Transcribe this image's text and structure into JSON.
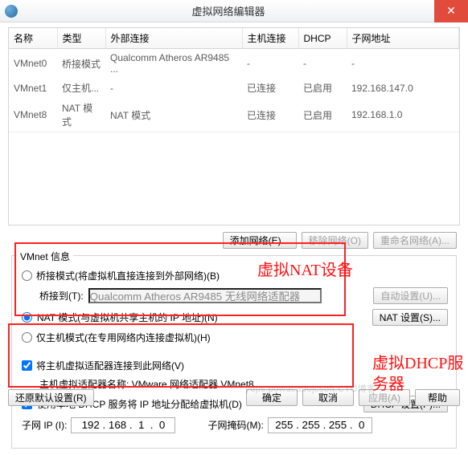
{
  "window": {
    "title": "虚拟网络编辑器",
    "close": "✕"
  },
  "table": {
    "headers": [
      "名称",
      "类型",
      "外部连接",
      "主机连接",
      "DHCP",
      "子网地址"
    ],
    "rows": [
      {
        "name": "VMnet0",
        "type": "桥接模式",
        "ext": "Qualcomm Atheros AR9485 ...",
        "host": "-",
        "dhcp": "-",
        "subnet": "-"
      },
      {
        "name": "VMnet1",
        "type": "仅主机...",
        "ext": "-",
        "host": "已连接",
        "dhcp": "已启用",
        "subnet": "192.168.147.0"
      },
      {
        "name": "VMnet8",
        "type": "NAT 模式",
        "ext": "NAT 模式",
        "host": "已连接",
        "dhcp": "已启用",
        "subnet": "192.168.1.0"
      }
    ]
  },
  "buttons": {
    "add_net": "添加网络(E)...",
    "remove_net": "移除网络(O)",
    "rename_net": "重命名网络(A)...",
    "auto_set": "自动设置(U)...",
    "nat_set": "NAT 设置(S)...",
    "dhcp_set": "DHCP 设置(P)...",
    "restore": "还原默认设置(R)",
    "ok": "确定",
    "cancel": "取消",
    "apply": "应用(A)",
    "help": "帮助"
  },
  "info": {
    "legend": "VMnet 信息",
    "bridge_opt": "桥接模式(将虚拟机直接连接到外部网络)(B)",
    "bridge_to_label": "桥接到(T):",
    "bridge_adapter": "Qualcomm Atheros AR9485 无线网络适配器",
    "nat_opt": "NAT 模式(与虚拟机共享主机的 IP 地址)(N)",
    "hostonly_opt": "仅主机模式(在专用网络内连接虚拟机)(H)",
    "host_adapter_chk": "将主机虚拟适配器连接到此网络(V)",
    "host_adapter_name": "主机虚拟适配器名称: VMware 网络适配器 VMnet8",
    "dhcp_chk": "使用本地 DHCP 服务将 IP 地址分配给虚拟机(D)",
    "subnet_ip_label": "子网 IP (I):",
    "subnet_ip": "192 . 168 .  1  .  0",
    "subnet_mask_label": "子网掩码(M):",
    "subnet_mask": "255 . 255 . 255 .  0"
  },
  "annotations": {
    "a1": "虚拟NAT设备",
    "a2": "虚拟DHCP服务器"
  },
  "watermark": "ydps:powacadojcsoft.CTO博客"
}
